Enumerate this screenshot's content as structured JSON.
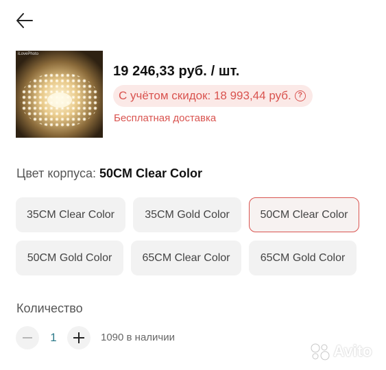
{
  "header": {
    "back_icon": "arrow-left-icon"
  },
  "product": {
    "thumb_watermark": "iLovePhoto",
    "price": "19 246,33 руб. / шт.",
    "discount_price": "С учётом скидок: 18 993,44 руб.",
    "info_icon": "?",
    "delivery": "Бесплатная доставка"
  },
  "color": {
    "label": "Цвет корпуса: ",
    "selected_value": "50CM Clear Color",
    "options": [
      {
        "label": "35CM Clear Color"
      },
      {
        "label": "35CM Gold Color"
      },
      {
        "label": "50CM Clear Color"
      },
      {
        "label": "50CM Gold Color"
      },
      {
        "label": "65CM Clear Color"
      },
      {
        "label": "65CM Gold Color"
      }
    ]
  },
  "quantity": {
    "label": "Количество",
    "value": "1",
    "stock": "1090 в наличии"
  },
  "watermark": {
    "text": "Avito"
  },
  "colors": {
    "accent": "#d9534f",
    "option_bg": "#f2f2f2",
    "quantity_value": "#2d7a8a"
  }
}
